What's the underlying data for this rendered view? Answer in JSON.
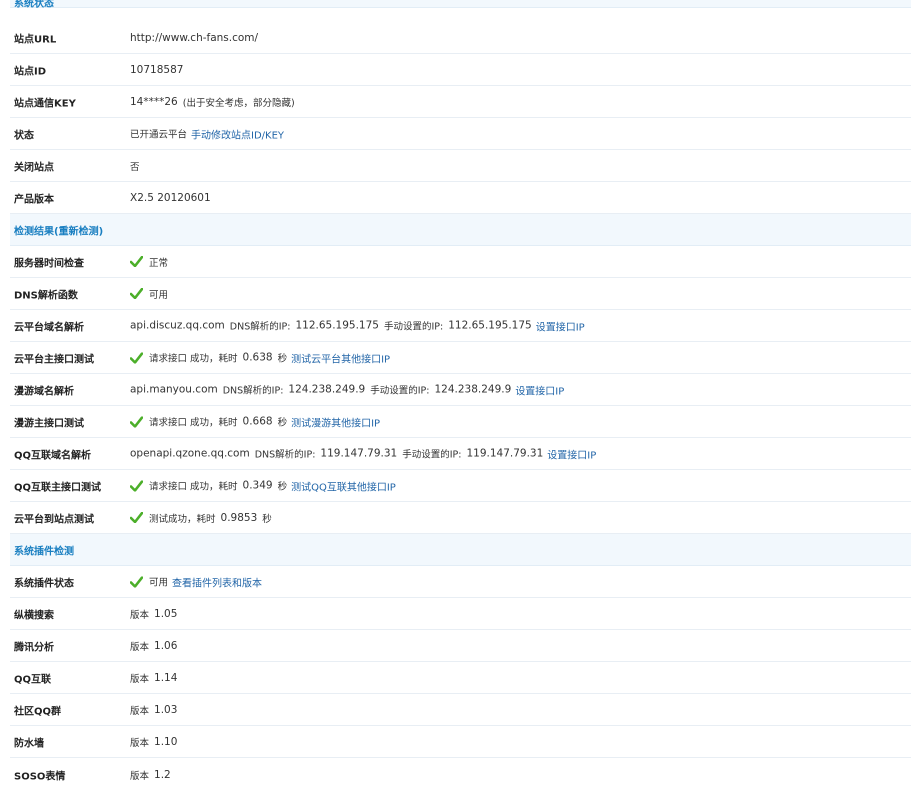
{
  "sections": {
    "status": {
      "title": "系统状态"
    },
    "check": {
      "title": "检测结果(重新检测)"
    },
    "plugin": {
      "title": "系统插件检测"
    }
  },
  "status_rows": [
    {
      "label": "站点URL",
      "value": "http://www.ch-fans.com/"
    },
    {
      "label": "站点ID",
      "value": "10718587"
    },
    {
      "label": "站点通信KEY",
      "value": "14****26",
      "note": "(出于安全考虑，部分隐藏)"
    },
    {
      "label": "状态",
      "value": "已开通云平台",
      "link": "手动修改站点ID/KEY"
    },
    {
      "label": "关闭站点",
      "value": "否"
    },
    {
      "label": "产品版本",
      "value": "X2.5 20120601"
    }
  ],
  "check_rows": {
    "server_time": {
      "label": "服务器时间检查",
      "status": "正常"
    },
    "dns_func": {
      "label": "DNS解析函数",
      "status": "可用"
    },
    "cloud_dns": {
      "label": "云平台域名解析",
      "host": "api.discuz.qq.com",
      "dns_label": "DNS解析的IP:",
      "dns_ip": "112.65.195.175",
      "manual_label": "手动设置的IP:",
      "manual_ip": "112.65.195.175",
      "link": "设置接口IP"
    },
    "cloud_api": {
      "label": "云平台主接口测试",
      "status": "请求接口 成功，耗时",
      "time": "0.638",
      "unit": "秒",
      "link": "测试云平台其他接口IP"
    },
    "manyou_dns": {
      "label": "漫游域名解析",
      "host": "api.manyou.com",
      "dns_label": "DNS解析的IP:",
      "dns_ip": "124.238.249.9",
      "manual_label": "手动设置的IP:",
      "manual_ip": "124.238.249.9",
      "link": "设置接口IP"
    },
    "manyou_api": {
      "label": "漫游主接口测试",
      "status": "请求接口 成功，耗时",
      "time": "0.668",
      "unit": "秒",
      "link": "测试漫游其他接口IP"
    },
    "qq_dns": {
      "label": "QQ互联域名解析",
      "host": "openapi.qzone.qq.com",
      "dns_label": "DNS解析的IP:",
      "dns_ip": "119.147.79.31",
      "manual_label": "手动设置的IP:",
      "manual_ip": "119.147.79.31",
      "link": "设置接口IP"
    },
    "qq_api": {
      "label": "QQ互联主接口测试",
      "status": "请求接口 成功，耗时",
      "time": "0.349",
      "unit": "秒",
      "link": "测试QQ互联其他接口IP"
    },
    "cloud_site": {
      "label": "云平台到站点测试",
      "status": "测试成功，耗时",
      "time": "0.9853",
      "unit": "秒"
    }
  },
  "plugin_status": {
    "label": "系统插件状态",
    "status": "可用",
    "link": "查看插件列表和版本"
  },
  "plugins": [
    {
      "label": "纵横搜索",
      "version_label": "版本",
      "version": "1.05"
    },
    {
      "label": "腾讯分析",
      "version_label": "版本",
      "version": "1.06"
    },
    {
      "label": "QQ互联",
      "version_label": "版本",
      "version": "1.14"
    },
    {
      "label": "社区QQ群",
      "version_label": "版本",
      "version": "1.03"
    },
    {
      "label": "防水墙",
      "version_label": "版本",
      "version": "1.10"
    },
    {
      "label": "SOSO表情",
      "version_label": "版本",
      "version": "1.2"
    }
  ],
  "colors": {
    "check": "#4caf2a",
    "link": "#2366a8",
    "section_bg": "#f2f8fd",
    "section_text": "#1a7fc1"
  },
  "icons": {
    "check": "check-icon"
  }
}
